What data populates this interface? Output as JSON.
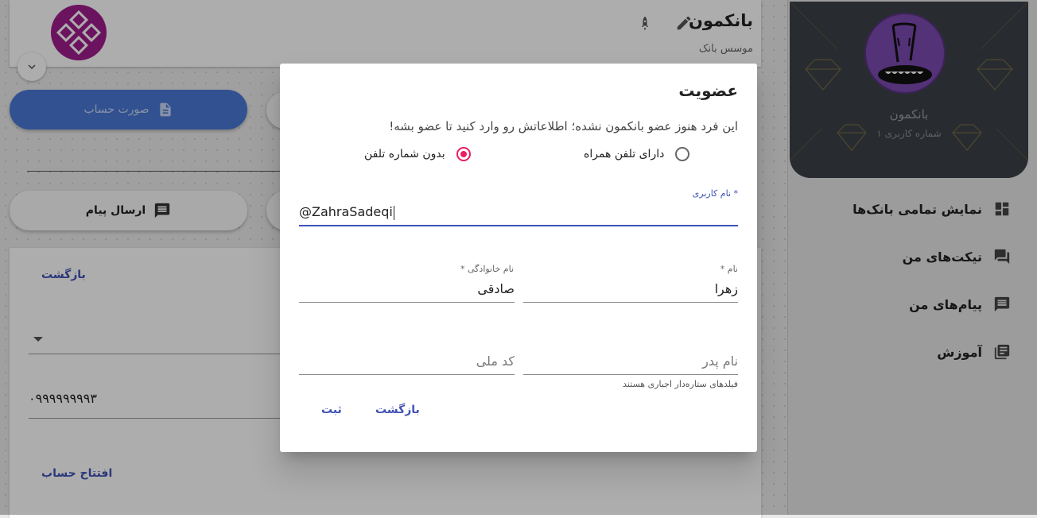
{
  "header": {
    "bank_title": "بانکمون",
    "bank_subtitle": "موسس بانک",
    "icons": [
      "edit-icon",
      "rocket-icon",
      "expand-more-icon"
    ]
  },
  "actions": {
    "statement_label": "صورت حساب",
    "send_message_label": "ارسال پیام"
  },
  "lower": {
    "back_label": "بازگشت",
    "phone_value": "۰۹۹۹۹۹۹۹۹۳",
    "open_account_label": "افتتاح حساب"
  },
  "sidebar": {
    "profile_name": "بانکمون",
    "profile_number": "شماره کاربری ۱",
    "items": [
      {
        "label": "نمایش تمامی بانک‌ها",
        "icon": "dashboard-icon"
      },
      {
        "label": "تیکت‌های من",
        "icon": "forum-icon"
      },
      {
        "label": "پیام‌های من",
        "icon": "message-icon"
      },
      {
        "label": "آموزش",
        "icon": "library-books-icon"
      }
    ]
  },
  "dialog": {
    "title": "عضویت",
    "description": "این فرد هنوز عضو بانکمون نشده؛ اطلاعاتش رو وارد کنید تا عضو بشه!",
    "radio_with_phone": "دارای تلفن همراه",
    "radio_without_phone": "بدون شماره تلفن",
    "selected_radio": "بدون شماره تلفن",
    "username_label": "* نام کاربری",
    "username_value": "@ZahraSadeqi",
    "first_name_label": "نام *",
    "first_name_value": "زهرا",
    "last_name_label": "نام خانوادگی *",
    "last_name_value": "صادقی",
    "father_name_placeholder": "نام پدر",
    "national_code_placeholder": "کد ملی",
    "hint": "فیلدهای ستاره‌دار اجباری هستند",
    "back_button": "بازگشت",
    "submit_button": "ثبت",
    "accent_color": "#3f51b5",
    "radio_color": "#e91e63"
  }
}
